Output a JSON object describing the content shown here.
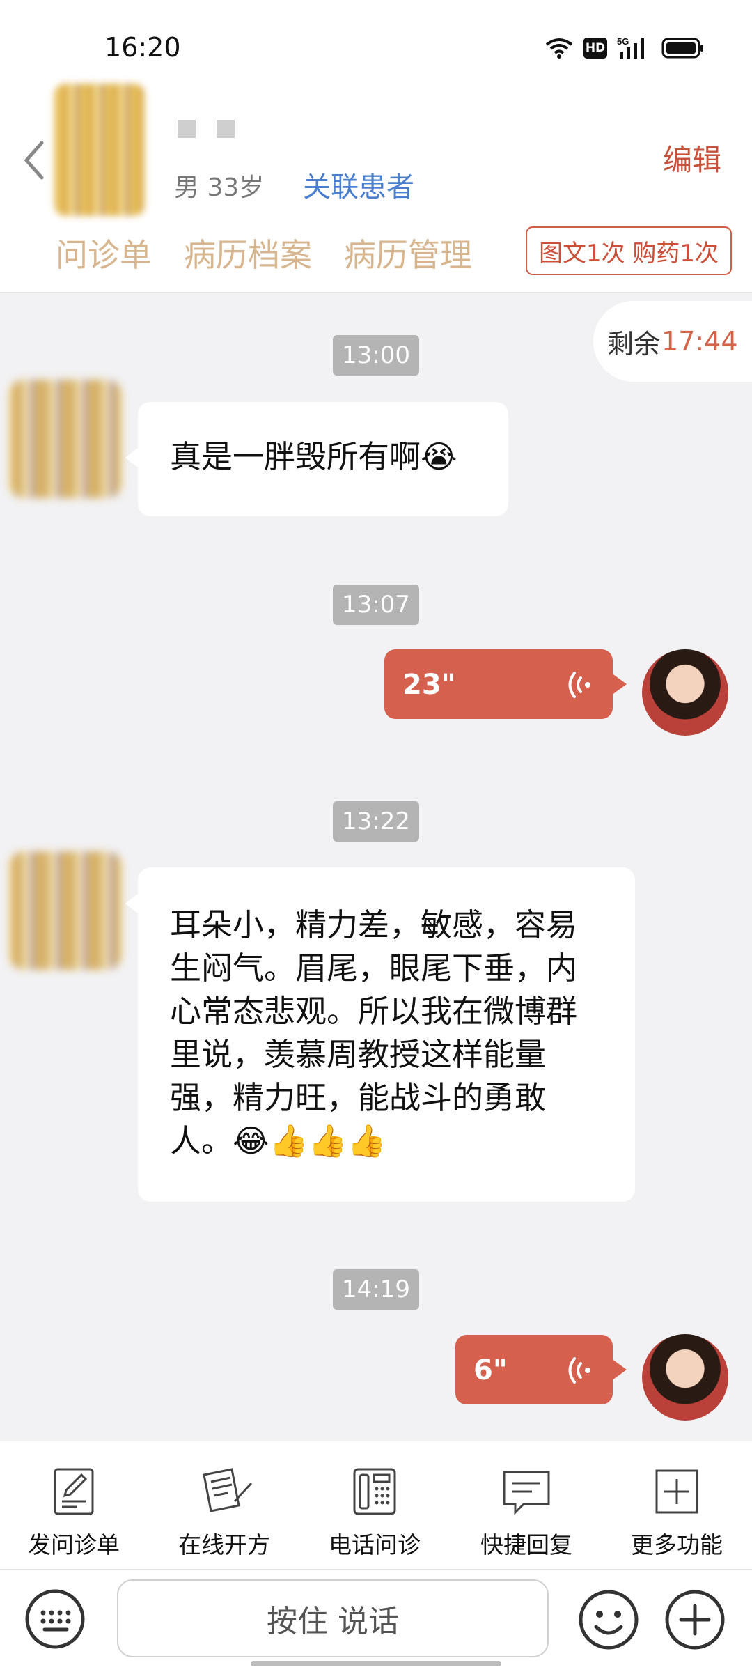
{
  "status_bar": {
    "time": "16:20",
    "hd_label": "HD",
    "network_label": "5G",
    "icons": [
      "wifi-icon",
      "hd-icon",
      "signal-icon",
      "battery-icon"
    ]
  },
  "header": {
    "back_icon": "back-arrow-icon",
    "gender_age": "男 33岁",
    "link_patient": "关联患者",
    "edit_label": "编辑",
    "tabs": [
      {
        "label": "问诊单"
      },
      {
        "label": "病历档案"
      },
      {
        "label": "病历管理"
      }
    ],
    "usage_badge": "图文1次 购药1次"
  },
  "chat": {
    "remaining_label": "剩余",
    "remaining_time": "17:44",
    "timestamps": [
      "13:00",
      "13:07",
      "13:22",
      "14:19"
    ],
    "messages": [
      {
        "from": "patient",
        "type": "text",
        "text": "真是一胖毁所有啊😭"
      },
      {
        "from": "doctor",
        "type": "voice",
        "duration": "23\""
      },
      {
        "from": "patient",
        "type": "text",
        "lines": [
          "耳朵小，精力差，敏感，容易",
          "生闷气。眉尾，眼尾下垂，内",
          "心常态悲观。所以我在微博群",
          "里说，羡慕周教授这样能量",
          "强，精力旺，能战斗的勇敢",
          "人。😂👍👍👍"
        ]
      },
      {
        "from": "doctor",
        "type": "voice",
        "duration": "6\""
      }
    ]
  },
  "toolbar": {
    "items": [
      {
        "label": "发问诊单",
        "icon": "form-edit-icon"
      },
      {
        "label": "在线开方",
        "icon": "prescription-icon"
      },
      {
        "label": "电话问诊",
        "icon": "phone-icon"
      },
      {
        "label": "快捷回复",
        "icon": "quick-reply-icon"
      },
      {
        "label": "更多功能",
        "icon": "more-plus-icon"
      }
    ]
  },
  "input_bar": {
    "talk_label": "按住 说话",
    "icons": [
      "keyboard-icon",
      "emoji-icon",
      "plus-icon"
    ]
  },
  "colors": {
    "accent": "#d6604e",
    "link": "#4a7fcf",
    "tab": "#d7b58f",
    "background": "#f2f2f4"
  }
}
